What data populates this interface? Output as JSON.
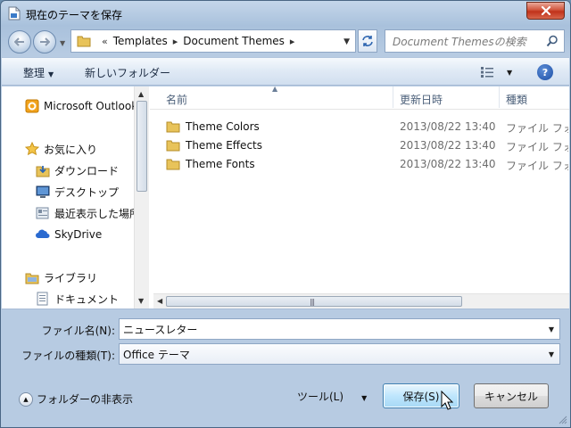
{
  "window": {
    "title": "現在のテーマを保存"
  },
  "address": {
    "breadcrumb": [
      "Templates",
      "Document Themes"
    ],
    "search_placeholder": "Document Themesの検索"
  },
  "toolbar": {
    "organize": "整理",
    "new_folder": "新しいフォルダー"
  },
  "nav": {
    "items": [
      {
        "label": "Microsoft Outlook",
        "icon": "outlook-icon"
      },
      {
        "label": "お気に入り",
        "icon": "star-icon"
      },
      {
        "label": "ダウンロード",
        "icon": "download-folder-icon"
      },
      {
        "label": "デスクトップ",
        "icon": "desktop-icon"
      },
      {
        "label": "最近表示した場所",
        "icon": "recent-places-icon"
      },
      {
        "label": "SkyDrive",
        "icon": "skydrive-icon"
      },
      {
        "label": "ライブラリ",
        "icon": "library-icon"
      },
      {
        "label": "ドキュメント",
        "icon": "documents-icon"
      }
    ]
  },
  "columns": {
    "name": "名前",
    "modified": "更新日時",
    "type": "種類"
  },
  "files": [
    {
      "name": "Theme Colors",
      "modified": "2013/08/22 13:40",
      "type": "ファイル フォルダー"
    },
    {
      "name": "Theme Effects",
      "modified": "2013/08/22 13:40",
      "type": "ファイル フォルダー"
    },
    {
      "name": "Theme Fonts",
      "modified": "2013/08/22 13:40",
      "type": "ファイル フォルダー"
    }
  ],
  "form": {
    "filename_label": "ファイル名(N):",
    "filename_value": "ニュースレター",
    "filetype_label": "ファイルの種類(T):",
    "filetype_value": "Office テーマ"
  },
  "footer": {
    "hide_folders": "フォルダーの非表示",
    "tools": "ツール(L)",
    "save": "保存(S)",
    "cancel": "キャンセル"
  },
  "colors": {
    "accent": "#3c7fb1",
    "close_red": "#c1321a",
    "folder_yellow": "#e8c35a"
  }
}
